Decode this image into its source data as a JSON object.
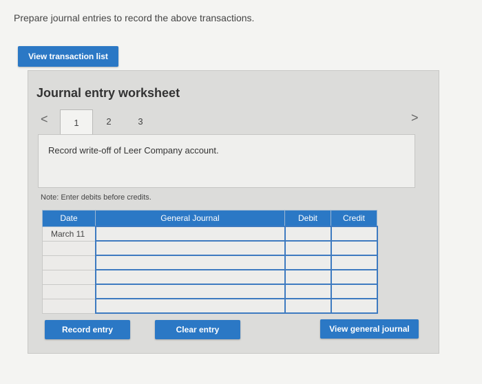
{
  "instruction": "Prepare journal entries to record the above transactions.",
  "view_transaction_list_label": "View transaction list",
  "worksheet": {
    "title": "Journal entry worksheet",
    "nav_prev": "<",
    "nav_next": ">",
    "tabs": [
      "1",
      "2",
      "3"
    ],
    "active_tab": "1",
    "description": "Record write-off of Leer Company account.",
    "note": "Note: Enter debits before credits.",
    "columns": {
      "date": "Date",
      "general_journal": "General Journal",
      "debit": "Debit",
      "credit": "Credit"
    },
    "rows": [
      {
        "date": "March 11"
      },
      {
        "date": ""
      },
      {
        "date": ""
      },
      {
        "date": ""
      },
      {
        "date": ""
      },
      {
        "date": ""
      }
    ],
    "buttons": {
      "record_entry": "Record entry",
      "clear_entry": "Clear entry",
      "view_general_journal": "View general journal"
    }
  },
  "colors": {
    "accent": "#2b78c5",
    "background": "#f4f4f2",
    "panel": "#dcdcda"
  }
}
